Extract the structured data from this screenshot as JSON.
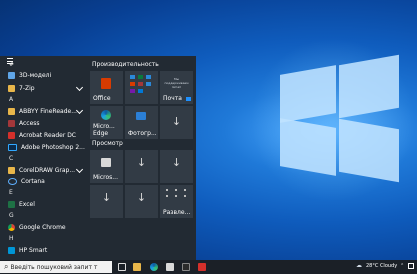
{
  "start_menu": {
    "letters": {
      "hash": "#",
      "a": "A",
      "c": "C",
      "e": "E",
      "g": "G",
      "h": "H"
    },
    "apps": {
      "model3d": "3D-моделі",
      "zip": "7-Zip",
      "abbyy": "ABBYY FineReade...",
      "access": "Access",
      "acrobat": "Acrobat Reader DC",
      "photoshop": "Adobe Photoshop 2...",
      "coreldraw": "CorelDRAW Grap...",
      "cortana": "Cortana",
      "excel": "Excel",
      "chrome": "Google Chrome",
      "hp": "HP Smart"
    },
    "groups": {
      "productivity": "Производительность",
      "browse": "Просмотр"
    },
    "tiles": {
      "office": "Office",
      "mail_top": "Мы поддерживаем Gmail",
      "mail": "Почта",
      "edge": "Micro... Edge",
      "photos": "Фотогр...",
      "store": "Micros...",
      "play": "Развле..."
    }
  },
  "taskbar": {
    "search_placeholder": "Введіть пошуковий запит т",
    "weather": "28°C  Cloudy"
  },
  "colors": {
    "start_bg": "#222a33",
    "tile_bg": "#323b45",
    "taskbar_bg": "#1b2027",
    "accent": "#0078d7"
  }
}
